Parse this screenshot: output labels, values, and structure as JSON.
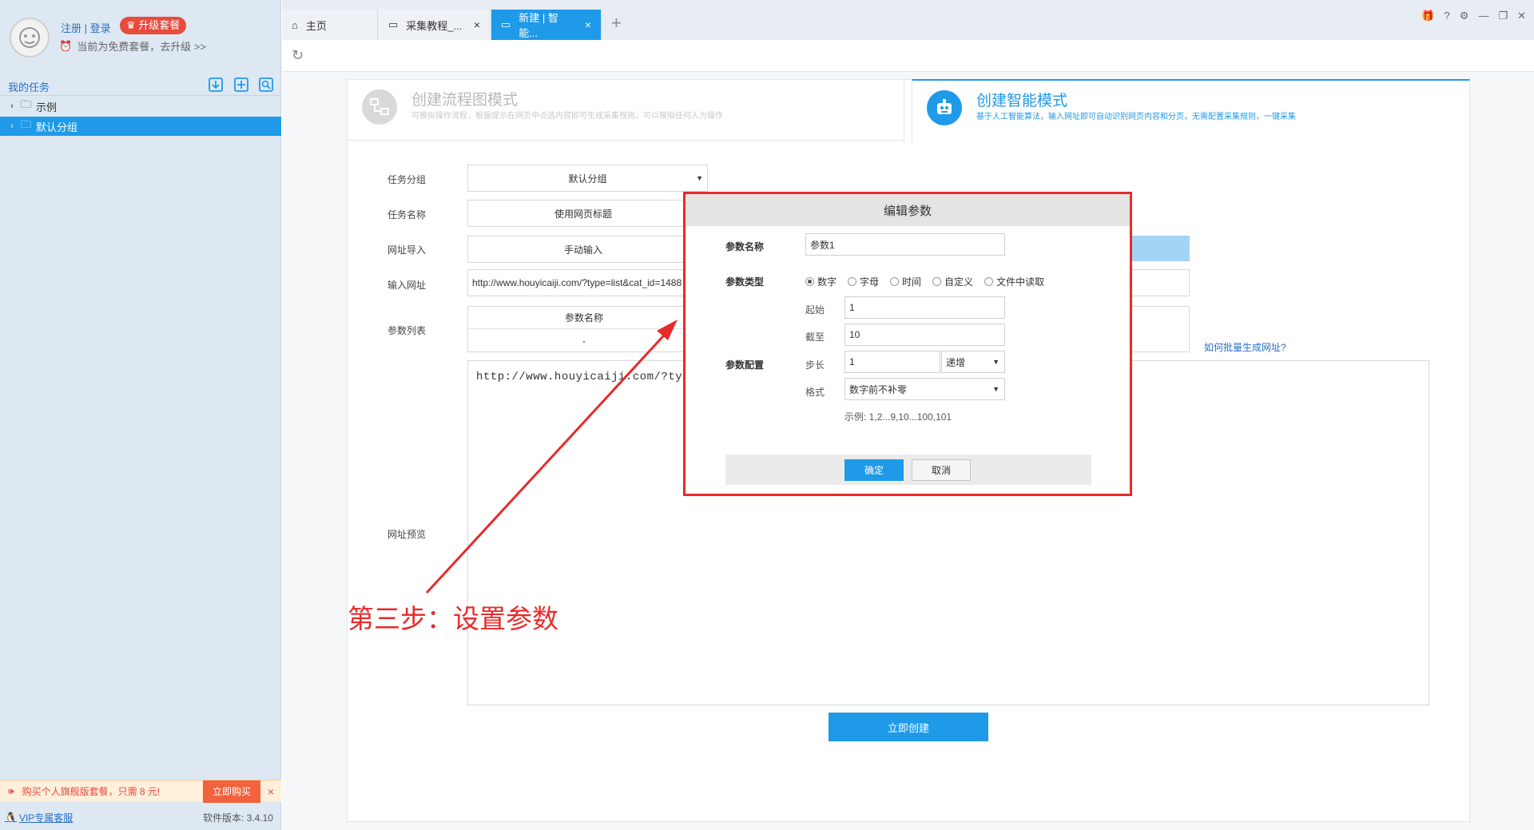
{
  "user": {
    "auth_link": "注册 | 登录",
    "upgrade_label": "升级套餐",
    "plan_note": "当前为免费套餐，去升级 >>"
  },
  "sidebar": {
    "title": "我的任务",
    "tree": [
      {
        "label": "示例"
      },
      {
        "label": "默认分组"
      }
    ],
    "promo": {
      "text": "购买个人旗舰版套餐，只需 8 元!",
      "buy_label": "立即购买"
    },
    "vip_link": "VIP专属客服",
    "version": "软件版本: 3.4.10"
  },
  "tabs": [
    {
      "label": "主页"
    },
    {
      "label": "采集教程_..."
    },
    {
      "label": "新建 | 智能..."
    }
  ],
  "modes": {
    "flow": {
      "title": "创建流程图模式",
      "desc": "可模拟操作流程，根据提示在网页中点选内容即可生成采集规则，可以模拟任何人为操作"
    },
    "smart": {
      "title": "创建智能模式",
      "desc": "基于人工智能算法，输入网址即可自动识别网页内容和分页，无需配置采集规则，一键采集"
    }
  },
  "form": {
    "group_label": "任务分组",
    "group_value": "默认分组",
    "name_label": "任务名称",
    "name_value": "使用网页标题",
    "import_label": "网址导入",
    "import_value": "手动输入",
    "url_label": "输入网址",
    "url_value": "http://www.houyicaiji.com/?type=list&cat_id=1488",
    "params_label": "参数列表",
    "params_header": "参数名称",
    "params_cell": "-",
    "batch_link": "如何批量生成网址?",
    "preview_label": "网址预览",
    "preview_text": "http://www.houyicaiji.com/?type=list",
    "create_label": "立即创建"
  },
  "dialog": {
    "title": "编辑参数",
    "name_label": "参数名称",
    "name_value": "参数1",
    "type_label": "参数类型",
    "types": [
      "数字",
      "字母",
      "时间",
      "自定义",
      "文件中读取"
    ],
    "selected_type": 0,
    "config_label": "参数配置",
    "start_label": "起始",
    "start_value": "1",
    "end_label": "截至",
    "end_value": "10",
    "step_label": "步长",
    "step_value": "1",
    "step_mode": "递增",
    "format_label": "格式",
    "format_value": "数字前不补零",
    "example": "示例: 1,2...9,10...100,101",
    "ok_label": "确定",
    "cancel_label": "取消"
  },
  "annotation": "第三步：设置参数",
  "colors": {
    "accent": "#1e9ae8",
    "highlight": "#e82a2a",
    "sidebar_bg": "#dde8f3"
  }
}
